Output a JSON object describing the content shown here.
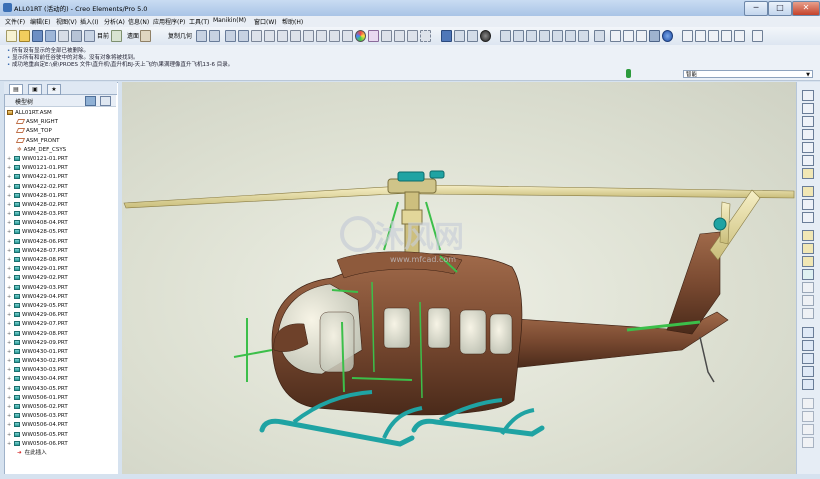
{
  "window": {
    "title": "ALL01RT (活动的) - Creo Elements/Pro 5.0",
    "controls": {
      "minimize": "─",
      "maximize": "□",
      "close": "✕"
    }
  },
  "menubar": {
    "items": [
      "文件(F)",
      "编辑(E)",
      "视图(V)",
      "插入(I)",
      "分析(A)",
      "信息(N)",
      "应用程序(P)",
      "工具(T)",
      "Manikin(M)",
      "窗口(W)",
      "帮助(H)"
    ]
  },
  "toolbar": {
    "regen_label": "目前",
    "appearance_label": "遗面",
    "copy_geometry_label": "复制几何"
  },
  "messages": [
    "所有设有显示的全部已被删除。",
    "显示所有和前任谷驶中的对象。没有对象将被找到。",
    "成功地重启定E:\\桌\\PROES 文件\\直升机\\直升机BJ-天上飞的\\果满理像直升飞机13-6 目录。"
  ],
  "smart_filter": {
    "value": "智能"
  },
  "panel": {
    "tree_title": "模型树",
    "root": "ALL01RT.ASM",
    "datums": [
      "ASM_RIGHT",
      "ASM_TOP",
      "ASM_FRONT",
      "ASM_DEF_CSYS"
    ],
    "parts": [
      "WW0121-01.PRT",
      "WW0121-01.PRT",
      "WW0422-01.PRT",
      "WW0422-02.PRT",
      "WW0428-01.PRT",
      "WW0428-02.PRT",
      "WW0428-03.PRT",
      "WW0408-04.PRT",
      "WW0428-05.PRT",
      "WW0428-06.PRT",
      "WW0428-07.PRT",
      "WW0428-08.PRT",
      "WW0429-01.PRT",
      "WW0429-02.PRT",
      "WW0429-03.PRT",
      "WW0429-04.PRT",
      "WW0429-05.PRT",
      "WW0429-06.PRT",
      "WW0429-07.PRT",
      "WW0429-08.PRT",
      "WW0429-09.PRT",
      "WW0430-01.PRT",
      "WW0430-02.PRT",
      "WW0430-03.PRT",
      "WW0430-04.PRT",
      "WW0430-05.PRT",
      "WW0506-01.PRT",
      "WW0506-02.PRT",
      "WW0506-03.PRT",
      "WW0506-04.PRT",
      "WW0506-05.PRT",
      "WW0506-06.PRT"
    ],
    "insert_here": "在此插入"
  },
  "watermark": {
    "text": "沐风网",
    "url": "www.mfcad.com"
  },
  "colors": {
    "fuselage": "#7a4a31",
    "rotor": "#e8dca0",
    "landing_gear": "#1fa3a3",
    "detail_green": "#3cbf4a",
    "background": "#dfe1d4"
  }
}
